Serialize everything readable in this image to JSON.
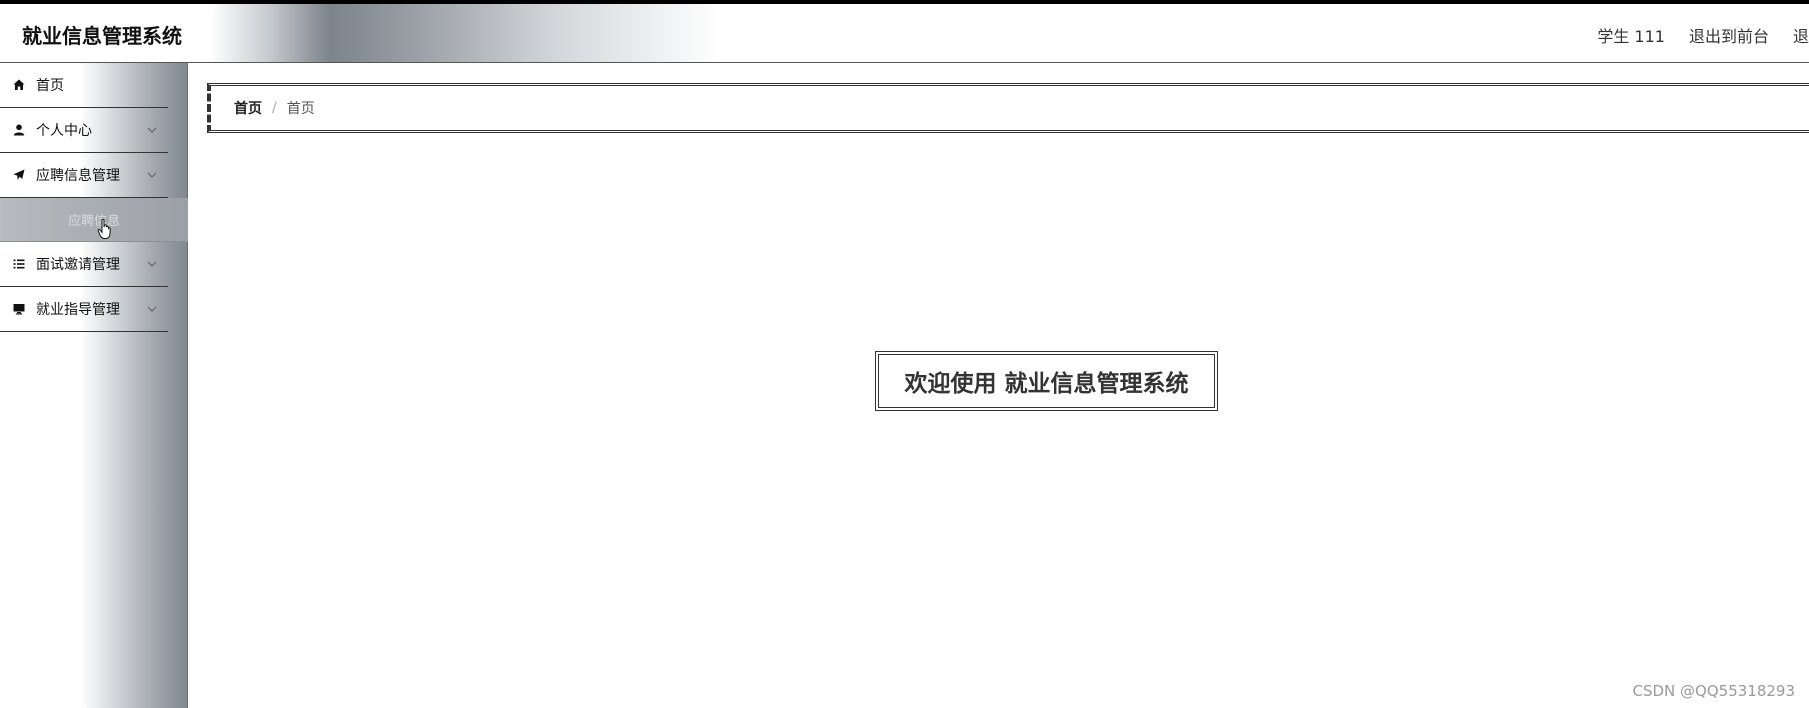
{
  "app": {
    "title": "就业信息管理系统"
  },
  "header": {
    "user_label": "学生 111",
    "front_link": "退出到前台",
    "logout_link": "退"
  },
  "sidebar": {
    "items": [
      {
        "label": "首页",
        "icon": "home-icon"
      },
      {
        "label": "个人中心",
        "icon": "user-icon",
        "expandable": true
      },
      {
        "label": "应聘信息管理",
        "icon": "paper-plane-icon",
        "expandable": true,
        "expanded": true,
        "children": [
          {
            "label": "应聘信息"
          }
        ]
      },
      {
        "label": "面试邀请管理",
        "icon": "list-icon",
        "expandable": true
      },
      {
        "label": "就业指导管理",
        "icon": "monitor-icon",
        "expandable": true
      }
    ]
  },
  "breadcrumb": {
    "home": "首页",
    "separator": "/",
    "current": "首页"
  },
  "main": {
    "welcome": "欢迎使用 就业信息管理系统"
  },
  "watermark": "CSDN @QQ55318293"
}
